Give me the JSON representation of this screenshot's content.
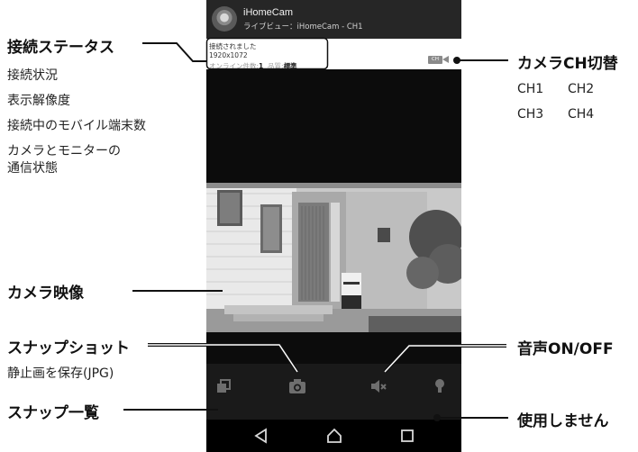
{
  "app": {
    "name": "iHomeCam",
    "subtitle": "ライブビュー：iHomeCam - CH1"
  },
  "status": {
    "connection": "接続されました",
    "resolution": "1920x1072",
    "online_label": "オンライン件数:",
    "online_count": "1",
    "quality_label": "品質:",
    "quality_value": "標準"
  },
  "ch_icon_label": "CH",
  "annotations": {
    "connection_status": {
      "title": "接続ステータス",
      "items": [
        "接続状況",
        "表示解像度",
        "接続中のモバイル端末数",
        "カメラとモニターの",
        "通信状態"
      ]
    },
    "camera_ch": {
      "title": "カメラCH切替",
      "ch1": "CH1",
      "ch2": "CH2",
      "ch3": "CH3",
      "ch4": "CH4"
    },
    "camera_view": {
      "title": "カメラ映像"
    },
    "snapshot": {
      "title": "スナップショット",
      "desc": "静止画を保存(JPG)"
    },
    "snapshot_list": {
      "title": "スナップ一覧"
    },
    "audio": {
      "title": "音声ON/OFF"
    },
    "unused": {
      "title": "使用しません"
    }
  },
  "icons": {
    "snapshot_list": "gallery-icon",
    "snapshot": "camera-icon",
    "audio": "speaker-mute-icon",
    "unused": "bulb-icon",
    "nav_back": "back-triangle-icon",
    "nav_home": "home-icon",
    "nav_recent": "recent-apps-icon"
  },
  "colors": {
    "annotation_line": "#111111",
    "phone_bg": "#0c0c0c",
    "toolbar_bg": "#1a1a1a"
  }
}
